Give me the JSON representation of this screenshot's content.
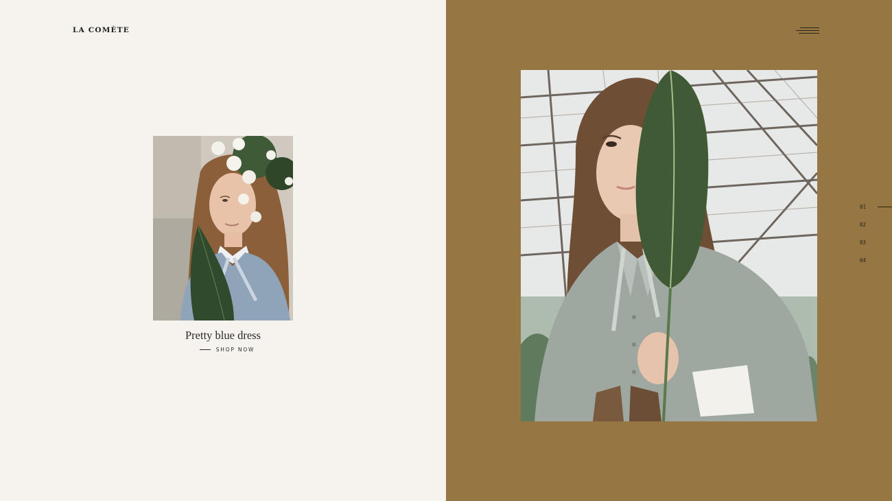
{
  "brand": {
    "name": "LA COMÈTE"
  },
  "product": {
    "title": "Pretty blue dress",
    "cta_label": "SHOP NOW"
  },
  "pager": {
    "items": [
      "01",
      "02",
      "03",
      "04"
    ],
    "active": "01"
  },
  "colors": {
    "left_bg": "#f6f3ef",
    "right_bg": "#967744",
    "text_dark": "#1c1c1c"
  }
}
